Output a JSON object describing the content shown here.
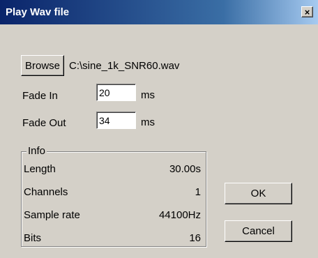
{
  "window": {
    "title": "Play Wav file",
    "close_glyph": "×"
  },
  "file": {
    "browse_label": "Browse",
    "path": "C:\\sine_1k_SNR60.wav"
  },
  "fade_in": {
    "label": "Fade In",
    "value": "20",
    "unit": "ms"
  },
  "fade_out": {
    "label": "Fade Out",
    "value": "34",
    "unit": "ms"
  },
  "info": {
    "title": "Info",
    "rows": [
      {
        "label": "Length",
        "value": "30.00s"
      },
      {
        "label": "Channels",
        "value": "1"
      },
      {
        "label": "Sample rate",
        "value": "44100Hz"
      },
      {
        "label": "Bits",
        "value": "16"
      }
    ]
  },
  "buttons": {
    "ok_label": "OK",
    "cancel_label": "Cancel"
  },
  "colors": {
    "face": "#d4d0c8",
    "title_start": "#0a246a",
    "title_end": "#a6caf0"
  }
}
